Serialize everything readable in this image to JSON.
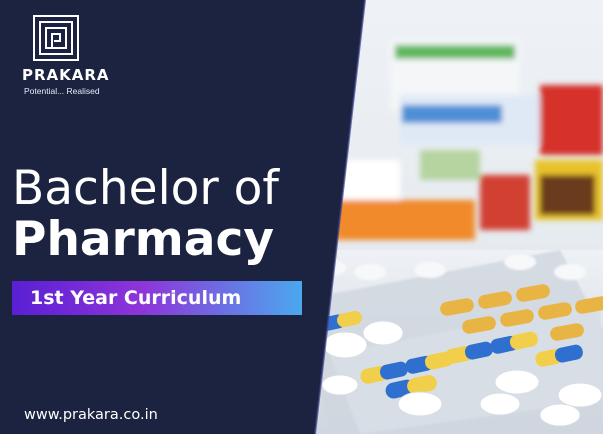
{
  "brand": {
    "name": "PRAKARA",
    "tagline": "Potential... Realised"
  },
  "title": {
    "line1": "Bachelor of",
    "line2": "Pharmacy"
  },
  "subtitle": "1st Year Curriculum",
  "website": "www.prakara.co.in",
  "colors": {
    "panel": "#1c2340",
    "ribbon_start": "#5a1fd4",
    "ribbon_end": "#4ba8ee",
    "text": "#ffffff"
  }
}
